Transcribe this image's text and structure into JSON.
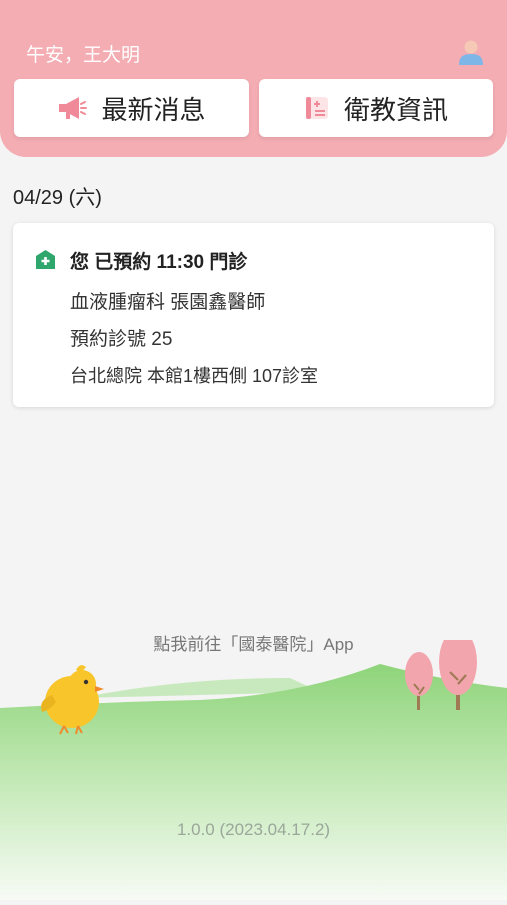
{
  "header": {
    "greeting": "午安，王大明",
    "user_icon": "user-icon",
    "buttons": [
      {
        "label": "最新消息",
        "icon": "megaphone-icon"
      },
      {
        "label": "衛教資訊",
        "icon": "health-info-icon"
      }
    ]
  },
  "date": "04/29 (六)",
  "appointment": {
    "icon": "hospital-icon",
    "title": "您 已預約 11:30 門診",
    "department_doctor": "血液腫瘤科 張園鑫醫師",
    "number": "預約診號 25",
    "location": "台北總院 本館1樓西側 107診室"
  },
  "app_link": "點我前往「國泰醫院」App",
  "version": "1.0.0 (2023.04.17.2)",
  "colors": {
    "header": "#f3adb3",
    "accent_icon": "#f08a98",
    "hospital_green": "#2fa66b",
    "grass": "#8ed47a"
  }
}
